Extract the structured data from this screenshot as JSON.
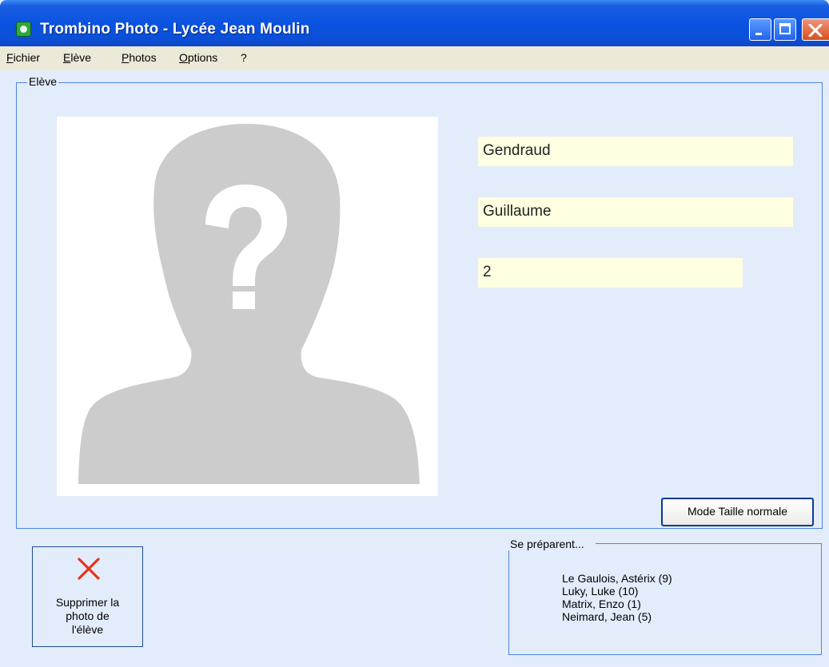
{
  "window": {
    "title": "Trombino Photo - Lycée Jean Moulin",
    "title_bar_color": "#0a53e0",
    "close_button_color": "#d8501e"
  },
  "menu": {
    "items": [
      {
        "label": "Fichier"
      },
      {
        "label": "Elève"
      },
      {
        "label": "Photos"
      },
      {
        "label": "Options"
      },
      {
        "label": "?"
      }
    ]
  },
  "eleve_group": {
    "label": "Elève",
    "photo_placeholder_icon": "unknown-person-silhouette",
    "last_name": "Gendraud",
    "first_name": "Guillaume",
    "number": "2",
    "field_background": "#ffffe1",
    "mode_button_label": "Mode Taille normale"
  },
  "delete_button": {
    "label": "Supprimer la photo de l'élève",
    "label_lines": [
      "Supprimer la",
      "photo de",
      "l'élève"
    ],
    "icon": "red-x-icon",
    "icon_color": "#e8331a"
  },
  "preparing_group": {
    "label": "Se préparent...",
    "items": [
      "Le Gaulois, Astérix (9)",
      "Luky, Luke (10)",
      "Matrix, Enzo (1)",
      "Neimard, Jean (5)"
    ]
  }
}
